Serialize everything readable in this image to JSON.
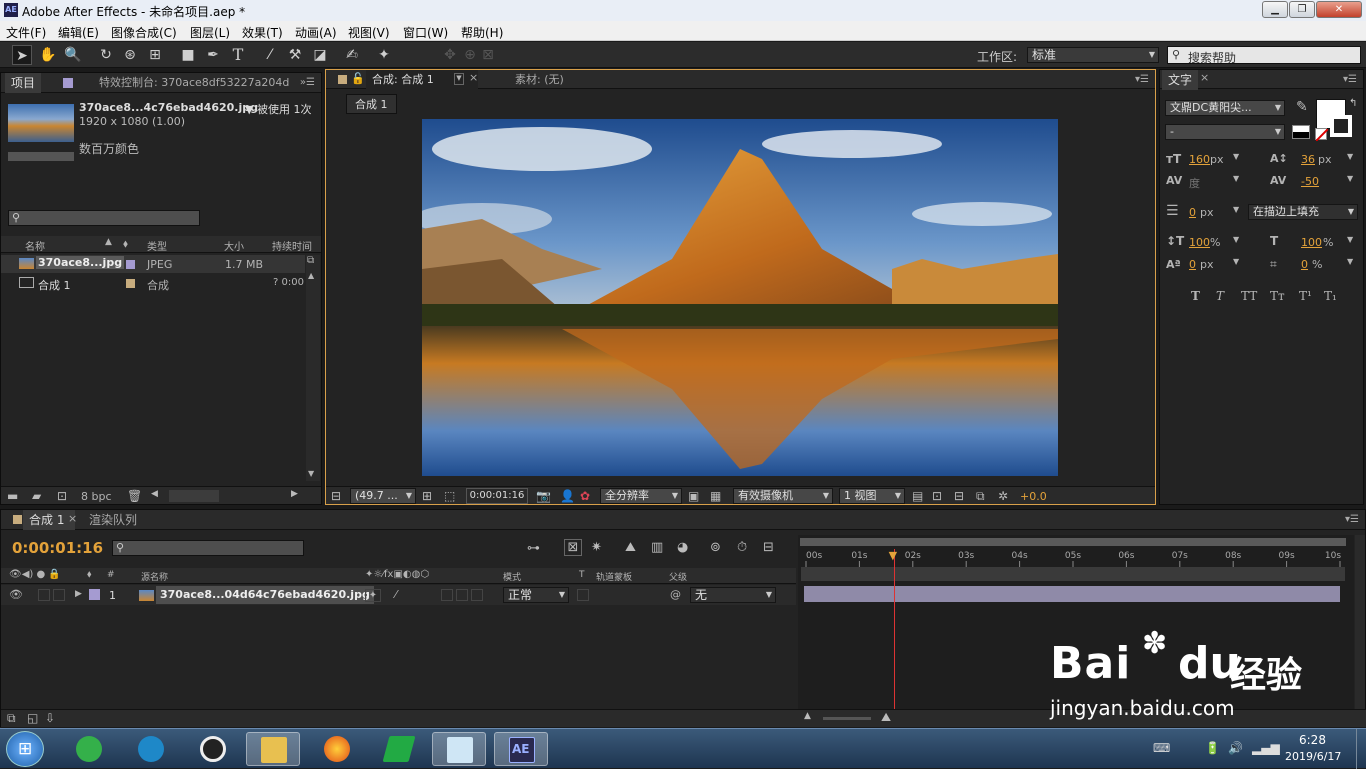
{
  "window": {
    "title": "Adobe After Effects - 未命名项目.aep *",
    "logo": "AE"
  },
  "menu": [
    "文件(F)",
    "编辑(E)",
    "图像合成(C)",
    "图层(L)",
    "效果(T)",
    "动画(A)",
    "视图(V)",
    "窗口(W)",
    "帮助(H)"
  ],
  "toolbar": {
    "workspace_label": "工作区:",
    "workspace_value": "标准",
    "search_placeholder": "搜索帮助"
  },
  "project": {
    "tab_project": "项目",
    "tab_effects": "特效控制台: 370ace8df53227a204d",
    "file_name": "370ace8...4c76ebad4620.jpg",
    "used": "▼ 被使用 1次",
    "dims": "1920 x 1080 (1.00)",
    "colors": "数百万颜色",
    "cols": {
      "name": "名称",
      "type": "类型",
      "size": "大小",
      "duration": "持续时间"
    },
    "items": [
      {
        "name": "370ace8...jpg",
        "type": "JPEG",
        "size": "1.7 MB",
        "duration": ""
      },
      {
        "name": "合成 1",
        "type": "合成",
        "size": "",
        "duration": "? 0:00"
      }
    ],
    "bpc": "8 bpc"
  },
  "comp": {
    "tab": "合成: 合成 1",
    "footage_tab": "素材: (无)",
    "crumb": "合成 1",
    "zoom": "(49.7 ...",
    "time": "0:00:01:16",
    "resolution": "全分辨率",
    "camera": "有效摄像机",
    "views": "1 视图",
    "exposure": "+0.0"
  },
  "text_panel": {
    "tab": "文字",
    "font": "文鼎DC黄阳尖...",
    "style": "-",
    "size": "160",
    "size_unit": "px",
    "leading": "36",
    "leading_unit": "px",
    "kerning": "度",
    "tracking": "-50",
    "stroke": "0",
    "stroke_unit": "px",
    "stroke_mode": "在描边上填充",
    "vscale": "100",
    "vscale_unit": "%",
    "hscale": "100",
    "hscale_unit": "%",
    "baseline": "0",
    "baseline_unit": "px",
    "tsume": "0",
    "tsume_unit": "%",
    "styles": [
      "T",
      "T",
      "TT",
      "Tт",
      "T¹",
      "T₁"
    ]
  },
  "timeline": {
    "tab": "合成 1",
    "render_tab": "渲染队列",
    "time": "0:00:01:16",
    "cols": {
      "source": "源名称",
      "mode": "模式",
      "t": "T",
      "trkmat": "轨道蒙板",
      "parent": "父级"
    },
    "layer": {
      "num": "1",
      "name": "370ace8...04d64c76ebad4620.jpg",
      "mode": "正常",
      "parent": "无"
    },
    "ruler": [
      "00s",
      "01s",
      "02s",
      "03s",
      "04s",
      "05s",
      "06s",
      "07s",
      "08s",
      "09s",
      "10s"
    ],
    "playhead_s": 1.64
  },
  "watermark": {
    "brand": "Bai",
    "brand2": "du",
    "cn": "经验",
    "url": "jingyan.baidu.com"
  },
  "taskbar": {
    "time": "6:28",
    "date": "2019/6/17",
    "ae_label": "AE"
  }
}
